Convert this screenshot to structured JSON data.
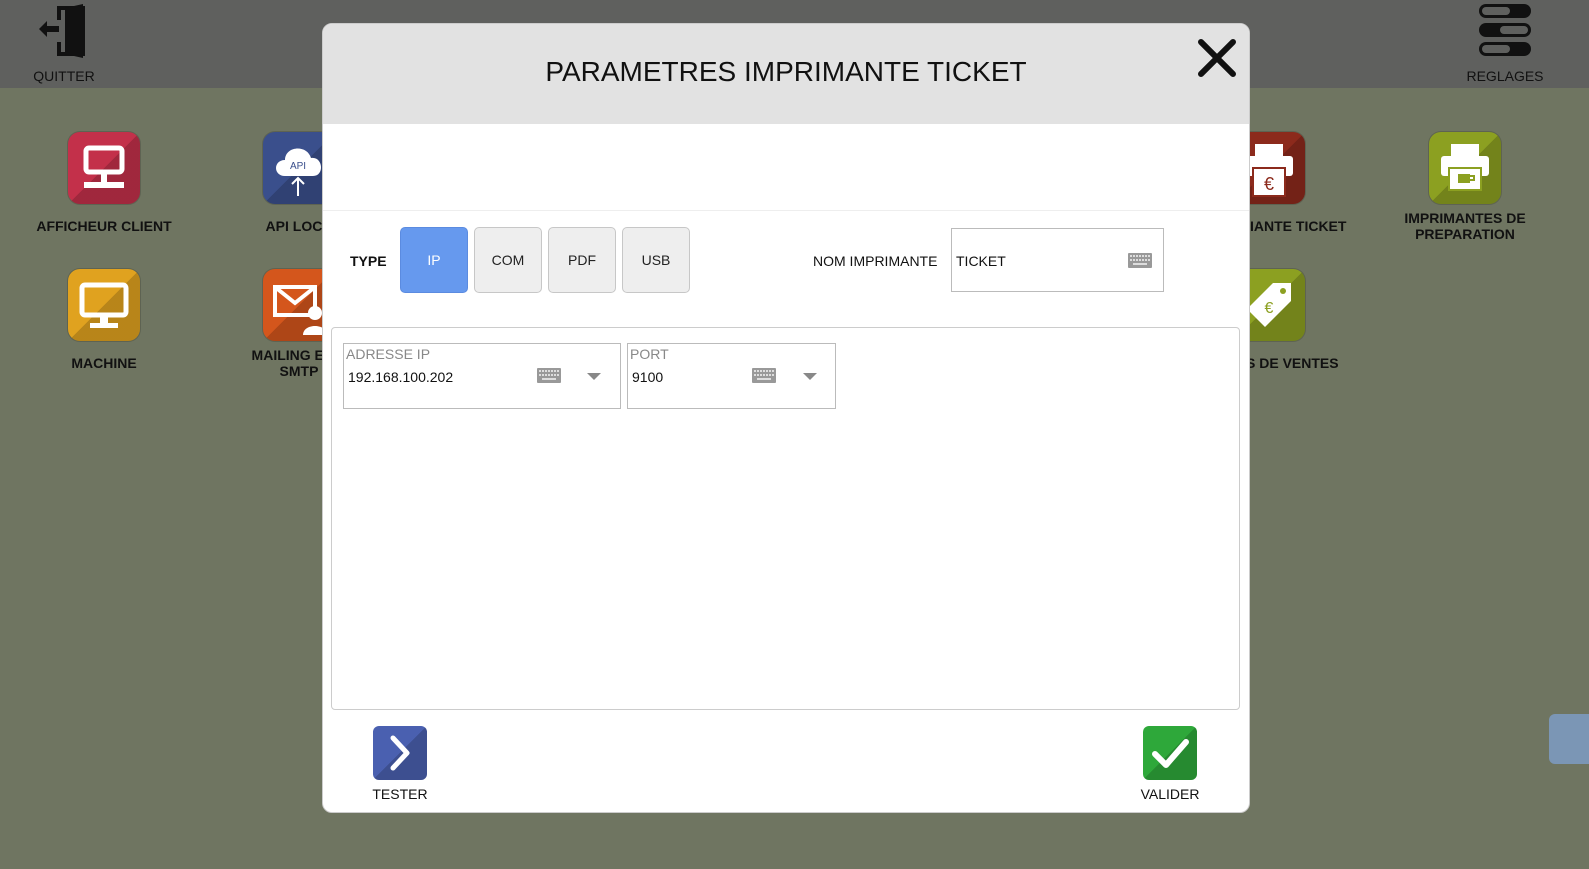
{
  "topbar": {
    "quit_label": "QUITTER",
    "settings_label": "REGLAGES"
  },
  "tiles": [
    {
      "label": "AFFICHEUR CLIENT",
      "color": "#c3304a"
    },
    {
      "label": "API LOCA",
      "color": "#3a4f8c"
    },
    {
      "label": "MACHINE",
      "color": "#e0a21f"
    },
    {
      "label": "MAILING ET C",
      "label2": "SMTP",
      "color": "#d4561c"
    },
    {
      "label": "IANTE TICKET",
      "color": "#8c2a1c"
    },
    {
      "label": "IMPRIMANTES DE",
      "label2": "PREPARATION",
      "color": "#8ca021"
    },
    {
      "label": "S DE VENTES",
      "color": "#8ca021"
    }
  ],
  "modal": {
    "title": "PARAMETRES IMPRIMANTE TICKET",
    "type_label": "TYPE",
    "type_options": [
      "IP",
      "COM",
      "PDF",
      "USB"
    ],
    "selected_type": "IP",
    "printer_name_label": "NOM IMPRIMANTE",
    "printer_name_value": "TICKET",
    "ip_label": "ADRESSE IP",
    "ip_value": "192.168.100.202",
    "port_label": "PORT",
    "port_value": "9100",
    "test_label": "TESTER",
    "validate_label": "VALIDER"
  },
  "colors": {
    "accent": "#6699ee",
    "test_button": "#4a60b0",
    "validate_button": "#2ea83a"
  }
}
